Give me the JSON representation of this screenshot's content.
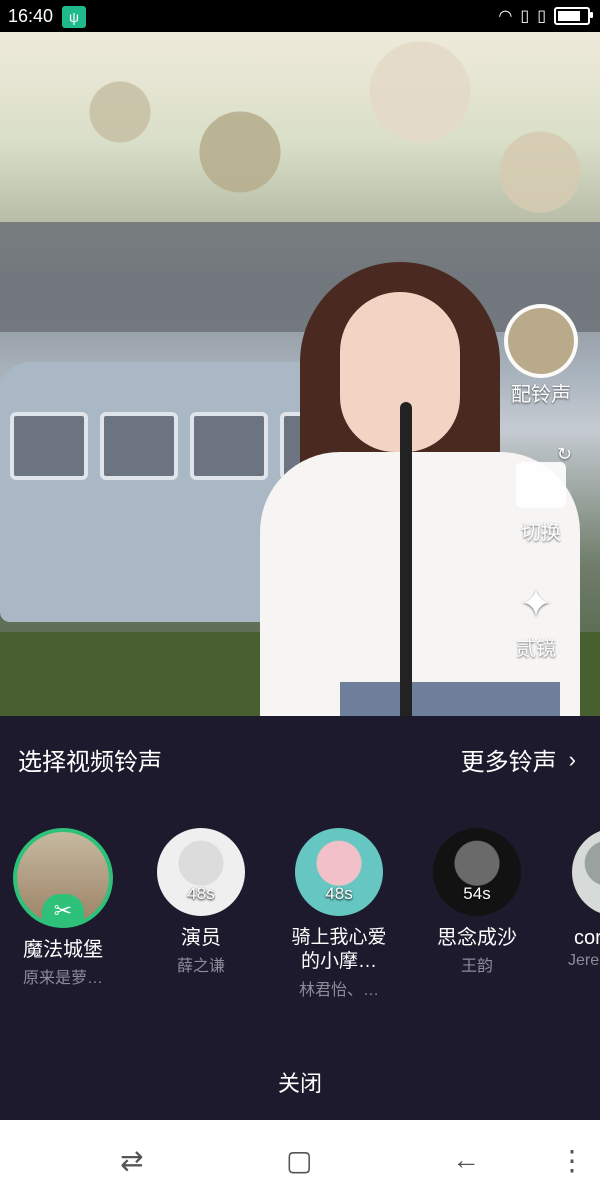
{
  "status_bar": {
    "time": "16:40",
    "usb_icon": "usb-icon"
  },
  "side_actions": {
    "ringtone_label": "配铃声",
    "switch_label": "切换",
    "effects_label": "贰镜"
  },
  "sheet": {
    "title": "选择视频铃声",
    "more_label": "更多铃声",
    "songs": [
      {
        "title": "魔法城堡",
        "artist": "原来是萝…",
        "duration": "",
        "selected": true
      },
      {
        "title": "演员",
        "artist": "薛之谦",
        "duration": "48s"
      },
      {
        "title": "骑上我心爱的小摩…",
        "artist": "林君怡、…",
        "duration": "48s"
      },
      {
        "title": "思念成沙",
        "artist": "王韵",
        "duration": "54s"
      },
      {
        "title": "cor",
        "artist": "Jere",
        "duration": ""
      }
    ],
    "close_label": "关闭"
  },
  "colors": {
    "accent": "#2ec179",
    "sheet_bg": "#1c1a2c"
  }
}
